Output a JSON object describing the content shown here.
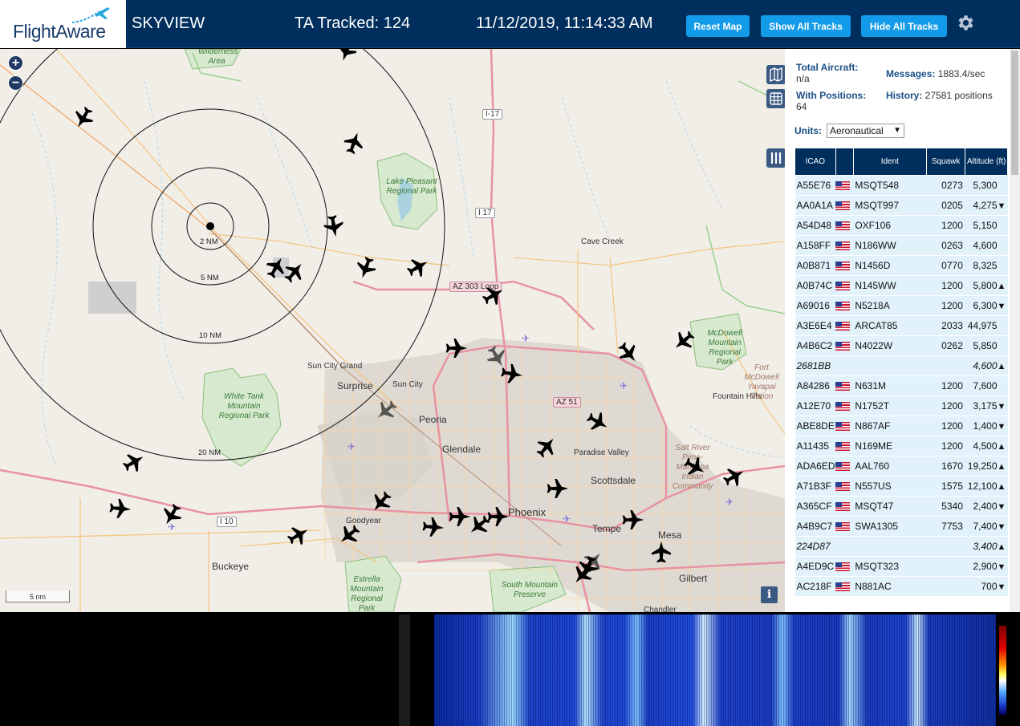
{
  "header": {
    "logo_text": "FlightAware",
    "app_title": "SKYVIEW",
    "ta_tracked": "TA Tracked: 124",
    "datetime": "11/12/2019, 11:14:33 AM",
    "buttons": {
      "reset_map": "Reset Map",
      "show_all": "Show All Tracks",
      "hide_all": "Hide All Tracks"
    },
    "settings_icon": "gear-icon"
  },
  "map": {
    "zoom_in": "+",
    "zoom_out": "−",
    "scale_label": "5 nm",
    "info_label": "i",
    "range_rings": [
      "2 NM",
      "5 NM",
      "10 NM",
      "20 NM"
    ],
    "cities": [
      "Surprise",
      "Sun City",
      "Sun City Grand",
      "Peoria",
      "Glendale",
      "Phoenix",
      "Scottsdale",
      "Paradise Valley",
      "Tempe",
      "Mesa",
      "Gilbert",
      "Goodyear",
      "Buckeye",
      "Cave Creek",
      "Fountain Hills",
      "Chandler"
    ],
    "parks": [
      "Lake Pleasant Regional Park",
      "White Tank Mountain Regional Park",
      "Estrella Mountain Regional Park",
      "South Mountain Preserve",
      "McDowell Mountain Regional Park",
      "Fort McDowell Yavapai Nation",
      "Salt River Pima-Maricopa Indian Community",
      "Wilderness Area"
    ],
    "shields": [
      "I-17",
      "I 17",
      "AZ 303 Loop",
      "AZ 51",
      "I 10"
    ]
  },
  "panel": {
    "total_aircraft_label": "Total Aircraft:",
    "total_aircraft_value": "n/a",
    "messages_label": "Messages:",
    "messages_value": "1883.4/sec",
    "with_positions_label": "With Positions:",
    "with_positions_value": "64",
    "history_label": "History:",
    "history_value": "27581 positions",
    "units_label": "Units:",
    "units_value": "Aeronautical",
    "columns": [
      "ICAO",
      "",
      "Ident",
      "Squawk",
      "Altitude (ft)"
    ],
    "rows": [
      {
        "icao": "A55E76",
        "ident": "MSQT548",
        "squawk": "0273",
        "alt": "5,300",
        "trend": ""
      },
      {
        "icao": "AA0A1A",
        "ident": "MSQT997",
        "squawk": "0205",
        "alt": "4,275",
        "trend": "▼"
      },
      {
        "icao": "A54D48",
        "ident": "OXF106",
        "squawk": "1200",
        "alt": "5,150",
        "trend": ""
      },
      {
        "icao": "A158FF",
        "ident": "N186WW",
        "squawk": "0263",
        "alt": "4,600",
        "trend": ""
      },
      {
        "icao": "A0B871",
        "ident": "N1456D",
        "squawk": "0770",
        "alt": "8,325",
        "trend": ""
      },
      {
        "icao": "A0B74C",
        "ident": "N145WW",
        "squawk": "1200",
        "alt": "5,800",
        "trend": "▲"
      },
      {
        "icao": "A69016",
        "ident": "N5218A",
        "squawk": "1200",
        "alt": "6,300",
        "trend": "▼"
      },
      {
        "icao": "A3E6E4",
        "ident": "ARCAT85",
        "squawk": "2033",
        "alt": "44,975",
        "trend": ""
      },
      {
        "icao": "A4B6C2",
        "ident": "N4022W",
        "squawk": "0262",
        "alt": "5,850",
        "trend": ""
      },
      {
        "icao": "2681BB",
        "ident": "",
        "squawk": "",
        "alt": "4,600",
        "trend": "▲",
        "style": "hl-yellow"
      },
      {
        "icao": "A84286",
        "ident": "N631M",
        "squawk": "1200",
        "alt": "7,600",
        "trend": ""
      },
      {
        "icao": "A12E70",
        "ident": "N1752T",
        "squawk": "1200",
        "alt": "3,175",
        "trend": "▼"
      },
      {
        "icao": "ABE8DE",
        "ident": "N867AF",
        "squawk": "1200",
        "alt": "1,400",
        "trend": "▼"
      },
      {
        "icao": "A11435",
        "ident": "N169ME",
        "squawk": "1200",
        "alt": "4,500",
        "trend": "▲"
      },
      {
        "icao": "ADA6ED",
        "ident": "AAL760",
        "squawk": "1670",
        "alt": "19,250",
        "trend": "▲"
      },
      {
        "icao": "A71B3F",
        "ident": "N557US",
        "squawk": "1575",
        "alt": "12,100",
        "trend": "▲"
      },
      {
        "icao": "A365CF",
        "ident": "MSQT47",
        "squawk": "5340",
        "alt": "2,400",
        "trend": "▼"
      },
      {
        "icao": "A4B9C7",
        "ident": "SWA1305",
        "squawk": "7753",
        "alt": "7,400",
        "trend": "▼"
      },
      {
        "icao": "224D87",
        "ident": "",
        "squawk": "",
        "alt": "3,400",
        "trend": "▲",
        "style": "hl-blue"
      },
      {
        "icao": "A4ED9C",
        "ident": "MSQT323",
        "squawk": "",
        "alt": "2,900",
        "trend": "▼"
      },
      {
        "icao": "AC218F",
        "ident": "N881AC",
        "squawk": "",
        "alt": "700",
        "trend": "▼"
      }
    ]
  },
  "colors": {
    "header_bg": "#002f5d",
    "button": "#139ae8",
    "row_bg": "#e1f2fb",
    "highlight_yellow": "#fdf3b7",
    "highlight_blue": "#c5d2ee"
  }
}
